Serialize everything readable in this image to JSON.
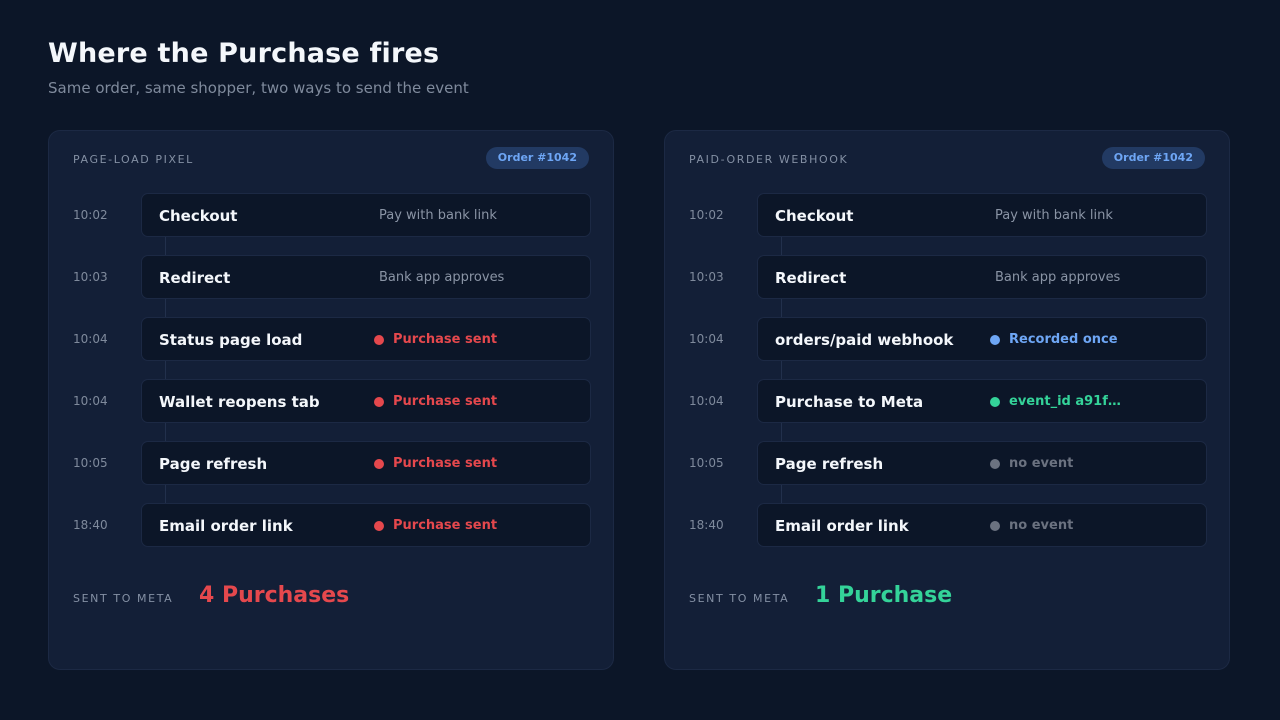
{
  "header": {
    "title": "Where the Purchase fires",
    "subtitle": "Same order, same shopper, two ways to send the event"
  },
  "colors": {
    "red": "#e5484d",
    "blue": "#6ea6f5",
    "green": "#34d399",
    "gray": "#6b7280"
  },
  "panels": [
    {
      "label": "PAGE-LOAD PIXEL",
      "badge": "Order #1042",
      "rows": [
        {
          "time": "10:02",
          "step": "Checkout",
          "status": "Pay with bank link",
          "kind": "neutral"
        },
        {
          "time": "10:03",
          "step": "Redirect",
          "status": "Bank app approves",
          "kind": "neutral"
        },
        {
          "time": "10:04",
          "step": "Status page load",
          "status": "Purchase sent",
          "kind": "red"
        },
        {
          "time": "10:04",
          "step": "Wallet reopens tab",
          "status": "Purchase sent",
          "kind": "red"
        },
        {
          "time": "10:05",
          "step": "Page refresh",
          "status": "Purchase sent",
          "kind": "red"
        },
        {
          "time": "18:40",
          "step": "Email order link",
          "status": "Purchase sent",
          "kind": "red"
        }
      ],
      "footer_label": "SENT TO META",
      "footer_value": "4 Purchases",
      "footer_kind": "red"
    },
    {
      "label": "PAID-ORDER WEBHOOK",
      "badge": "Order #1042",
      "rows": [
        {
          "time": "10:02",
          "step": "Checkout",
          "status": "Pay with bank link",
          "kind": "neutral"
        },
        {
          "time": "10:03",
          "step": "Redirect",
          "status": "Bank app approves",
          "kind": "neutral"
        },
        {
          "time": "10:04",
          "step": "orders/paid webhook",
          "status": "Recorded once",
          "kind": "blue"
        },
        {
          "time": "10:04",
          "step": "Purchase to Meta",
          "status": "event_id a91f…",
          "kind": "green"
        },
        {
          "time": "10:05",
          "step": "Page refresh",
          "status": "no event",
          "kind": "gray"
        },
        {
          "time": "18:40",
          "step": "Email order link",
          "status": "no event",
          "kind": "gray"
        }
      ],
      "footer_label": "SENT TO META",
      "footer_value": "1 Purchase",
      "footer_kind": "green"
    }
  ]
}
